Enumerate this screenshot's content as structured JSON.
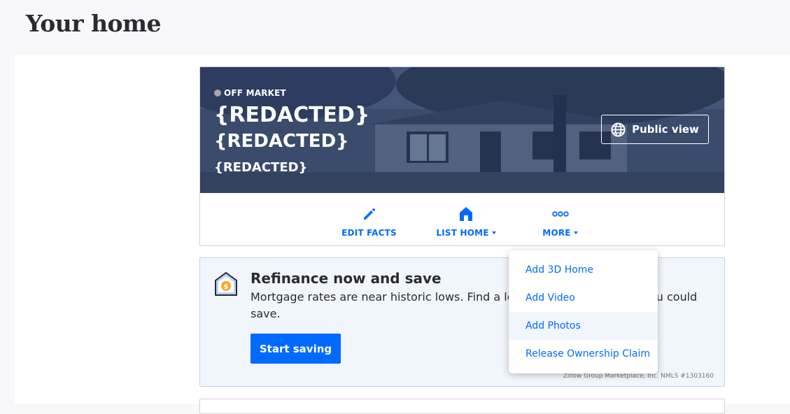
{
  "page": {
    "title": "Your home"
  },
  "home": {
    "status": "OFF MARKET",
    "address_line1": "{REDACTED}",
    "address_line2": "{REDACTED}",
    "address_line3": "{REDACTED}",
    "public_view_label": "Public view"
  },
  "actions": [
    {
      "label": "EDIT FACTS",
      "icon": "pencil-icon"
    },
    {
      "label": "LIST HOME",
      "icon": "house-icon",
      "has_dropdown": true
    },
    {
      "label": "MORE",
      "icon": "dots-icon",
      "has_dropdown": true
    }
  ],
  "more_menu": {
    "items": [
      {
        "label": "Add 3D Home"
      },
      {
        "label": "Add Video"
      },
      {
        "label": "Add Photos"
      },
      {
        "label": "Release Ownership Claim"
      }
    ]
  },
  "refinance": {
    "title": "Refinance now and save",
    "body": "Mortgage rates are near historic lows. Find a lender to see how much you could save.",
    "button_label": "Start saving",
    "disclaimer": "Zillow Group Marketplace, Inc. NMLS #1303160"
  },
  "colors": {
    "accent": "#006aff",
    "status_dot": "#a7a6ab",
    "refi_bg": "#f1f5fc"
  }
}
